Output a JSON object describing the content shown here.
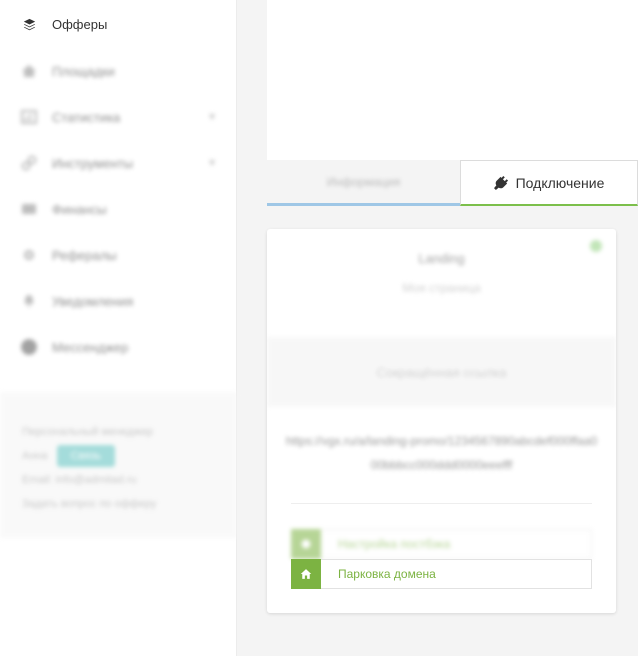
{
  "sidebar": {
    "items": [
      {
        "label": "Офферы",
        "icon": "layers-icon"
      },
      {
        "label": "Площадки",
        "icon": "home-icon"
      },
      {
        "label": "Статистика",
        "icon": "chart-icon",
        "has_submenu": true
      },
      {
        "label": "Инструменты",
        "icon": "link-icon",
        "has_submenu": true
      },
      {
        "label": "Финансы",
        "icon": "wallet-icon"
      },
      {
        "label": "Рефералы",
        "icon": "gear-icon"
      },
      {
        "label": "Уведомления",
        "icon": "bell-icon"
      },
      {
        "label": "Мессенджер",
        "icon": "globe-icon"
      }
    ],
    "footer": {
      "manager_text": "Персональный менеджер",
      "manager_name": "Анна",
      "contact_button": "Связь",
      "email_text": "Email: info@admitad.ru",
      "support_text": "Задать вопрос по офферу"
    }
  },
  "tabs": {
    "info_label": "Информация",
    "connection_label": "Подключение"
  },
  "card": {
    "title": "Landing",
    "subtitle": "Моя страница",
    "shared_label": "Сокращённая ссылка",
    "url": "https://vgx.ru/a/landing-promo/1234567890abcdef000ffaa000bbbcc000ddd0000eeefff",
    "buttons": [
      {
        "label": "Настройка постбэка",
        "icon": "settings-icon"
      },
      {
        "label": "Парковка домена",
        "icon": "home-icon"
      }
    ]
  },
  "colors": {
    "accent_green": "#7cb342",
    "tab_blue": "#9fc7e6",
    "status_dot": "#8fd07e",
    "teal_button": "#5bc0be"
  }
}
